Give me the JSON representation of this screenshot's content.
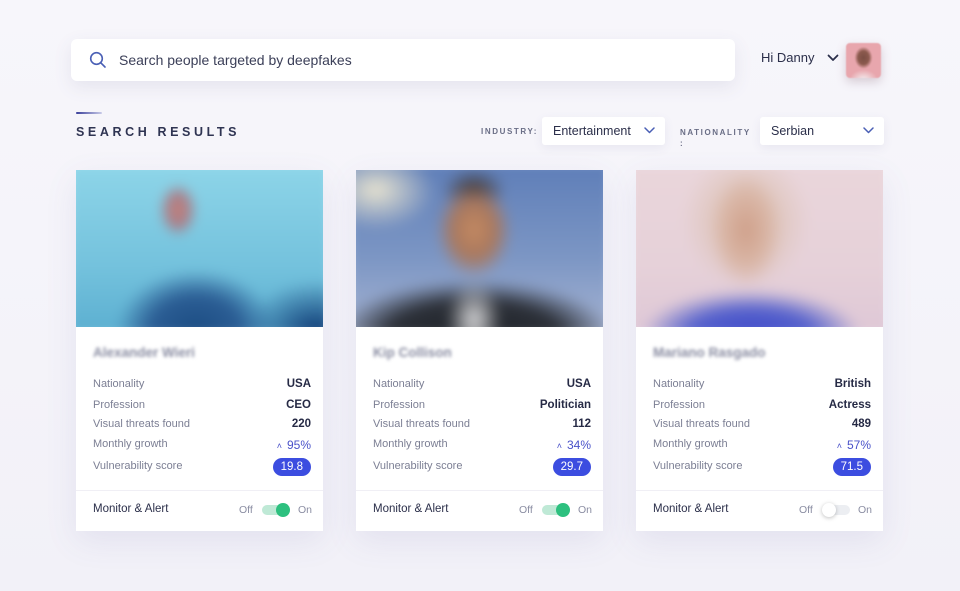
{
  "header": {
    "search_placeholder": "Search people targeted by deepfakes",
    "greeting": "Hi Danny",
    "icons": {
      "search": "search-icon",
      "user_menu": "chevron-down-icon",
      "avatar": "user-avatar"
    }
  },
  "section": {
    "title": "SEARCH RESULTS"
  },
  "filters": {
    "industry": {
      "label": "INDUSTRY:",
      "value": "Entertainment"
    },
    "nationality": {
      "label": "NATIONALITY :",
      "value": "Serbian"
    }
  },
  "labels": {
    "nationality": "Nationality",
    "profession": "Profession",
    "visual_threats": "Visual threats found",
    "monthly_growth": "Monthly growth",
    "vulnerability": "Vulnerability score",
    "monitor": "Monitor & Alert",
    "off": "Off",
    "on": "On"
  },
  "colors": {
    "accent": "#3c4de0",
    "growth": "#4a52c9",
    "toggle_on": "#2dc07f"
  },
  "cards": [
    {
      "name": "Alexander Wieri",
      "nationality": "USA",
      "profession": "CEO",
      "visual_threats": "220",
      "growth_caret": "^",
      "monthly_growth": "95%",
      "vulnerability": "19.8",
      "monitor_enabled": true
    },
    {
      "name": "Kip Collison",
      "nationality": "USA",
      "profession": "Politician",
      "visual_threats": "112",
      "growth_caret": "^",
      "monthly_growth": "34%",
      "vulnerability": "29.7",
      "monitor_enabled": true
    },
    {
      "name": "Mariano Rasgado",
      "nationality": "British",
      "profession": "Actress",
      "visual_threats": "489",
      "growth_caret": "^",
      "monthly_growth": "57%",
      "vulnerability": "71.5",
      "monitor_enabled": false
    }
  ]
}
